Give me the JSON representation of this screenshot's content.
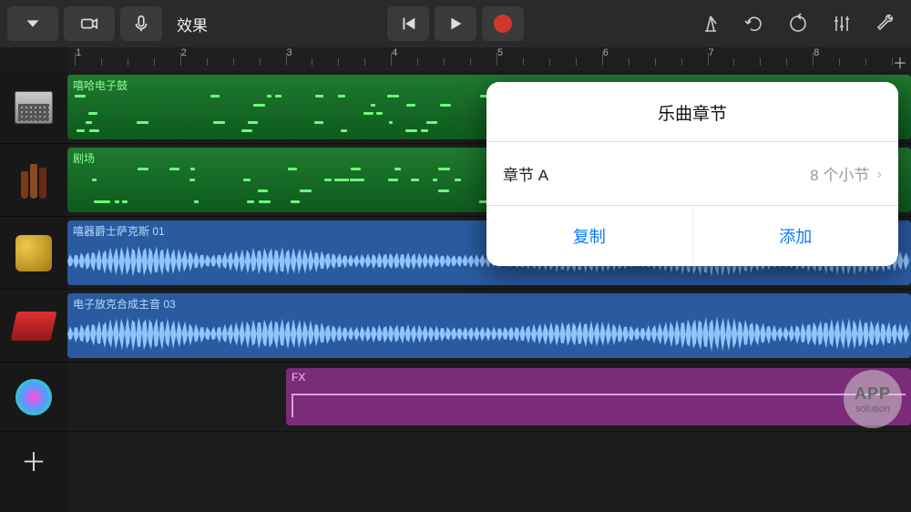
{
  "toolbar": {
    "fx_label": "效果"
  },
  "ruler": {
    "bars": [
      1,
      2,
      3,
      4,
      5,
      6,
      7,
      8
    ]
  },
  "tracks": [
    {
      "name": "嘻哈电子鼓",
      "color": "green",
      "type": "midi"
    },
    {
      "name": "剧场",
      "color": "green",
      "type": "midi"
    },
    {
      "name": "嘻器爵士萨克斯 01",
      "color": "blue",
      "type": "audio"
    },
    {
      "name": "电子放克合成主音 03",
      "color": "blue",
      "type": "audio"
    },
    {
      "name": "FX",
      "color": "purple",
      "type": "fx"
    }
  ],
  "popover": {
    "title": "乐曲章节",
    "section_name": "章节 A",
    "section_bars": "8 个小节",
    "copy": "复制",
    "add": "添加"
  },
  "watermark": {
    "line1": "APP",
    "line2": "solution"
  }
}
